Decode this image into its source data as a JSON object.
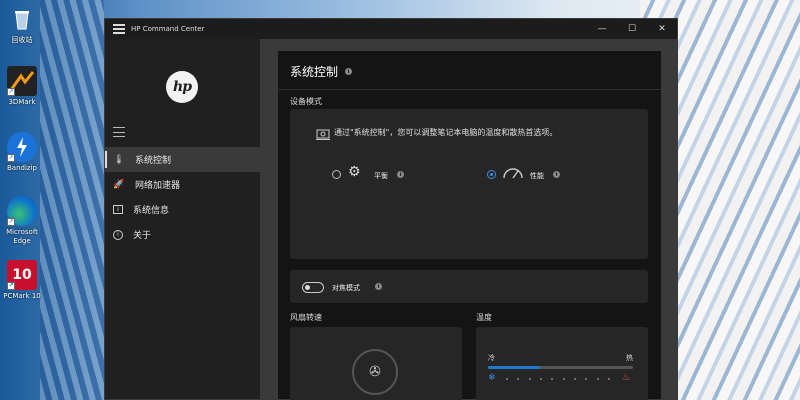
{
  "desktop": {
    "icons": [
      {
        "label": "回收站",
        "icon": "recycle-bin-icon"
      },
      {
        "label": "3DMark",
        "icon": "3dmark-icon"
      },
      {
        "label": "Bandizip",
        "icon": "bandizip-icon"
      },
      {
        "label": "Microsoft Edge",
        "icon": "edge-icon"
      },
      {
        "label": "PCMark 10",
        "icon": "pcmark-icon"
      }
    ]
  },
  "window": {
    "title": "HP Command Center",
    "controls": {
      "minimize": "—",
      "maximize": "☐",
      "close": "✕"
    }
  },
  "sidebar": {
    "logo": "hp",
    "items": [
      {
        "label": "系统控制",
        "icon": "thermometer-icon",
        "active": true
      },
      {
        "label": "网络加速器",
        "icon": "rocket-icon",
        "active": false
      },
      {
        "label": "系统信息",
        "icon": "info-box-icon",
        "active": false
      },
      {
        "label": "关于",
        "icon": "info-circle-icon",
        "active": false
      }
    ]
  },
  "main": {
    "title": "系统控制",
    "device_mode": {
      "label": "设备模式",
      "description": "通过\"系统控制\"，您可以调整笔记本电脑的温度和散热首选项。",
      "options": [
        {
          "label": "平衡",
          "icon": "gears-icon",
          "selected": false
        },
        {
          "label": "性能",
          "icon": "speedometer-icon",
          "selected": true
        }
      ]
    },
    "focus_mode": {
      "label": "对焦模式",
      "enabled": false
    },
    "fan_speed": {
      "label": "风扇转速",
      "icon": "fan-icon"
    },
    "temperature": {
      "label": "温度",
      "cold_label": "冷",
      "hot_label": "热",
      "level_percent": 36
    }
  },
  "colors": {
    "accent": "#3a8ee6",
    "panel": "#141414",
    "card": "#262626"
  }
}
